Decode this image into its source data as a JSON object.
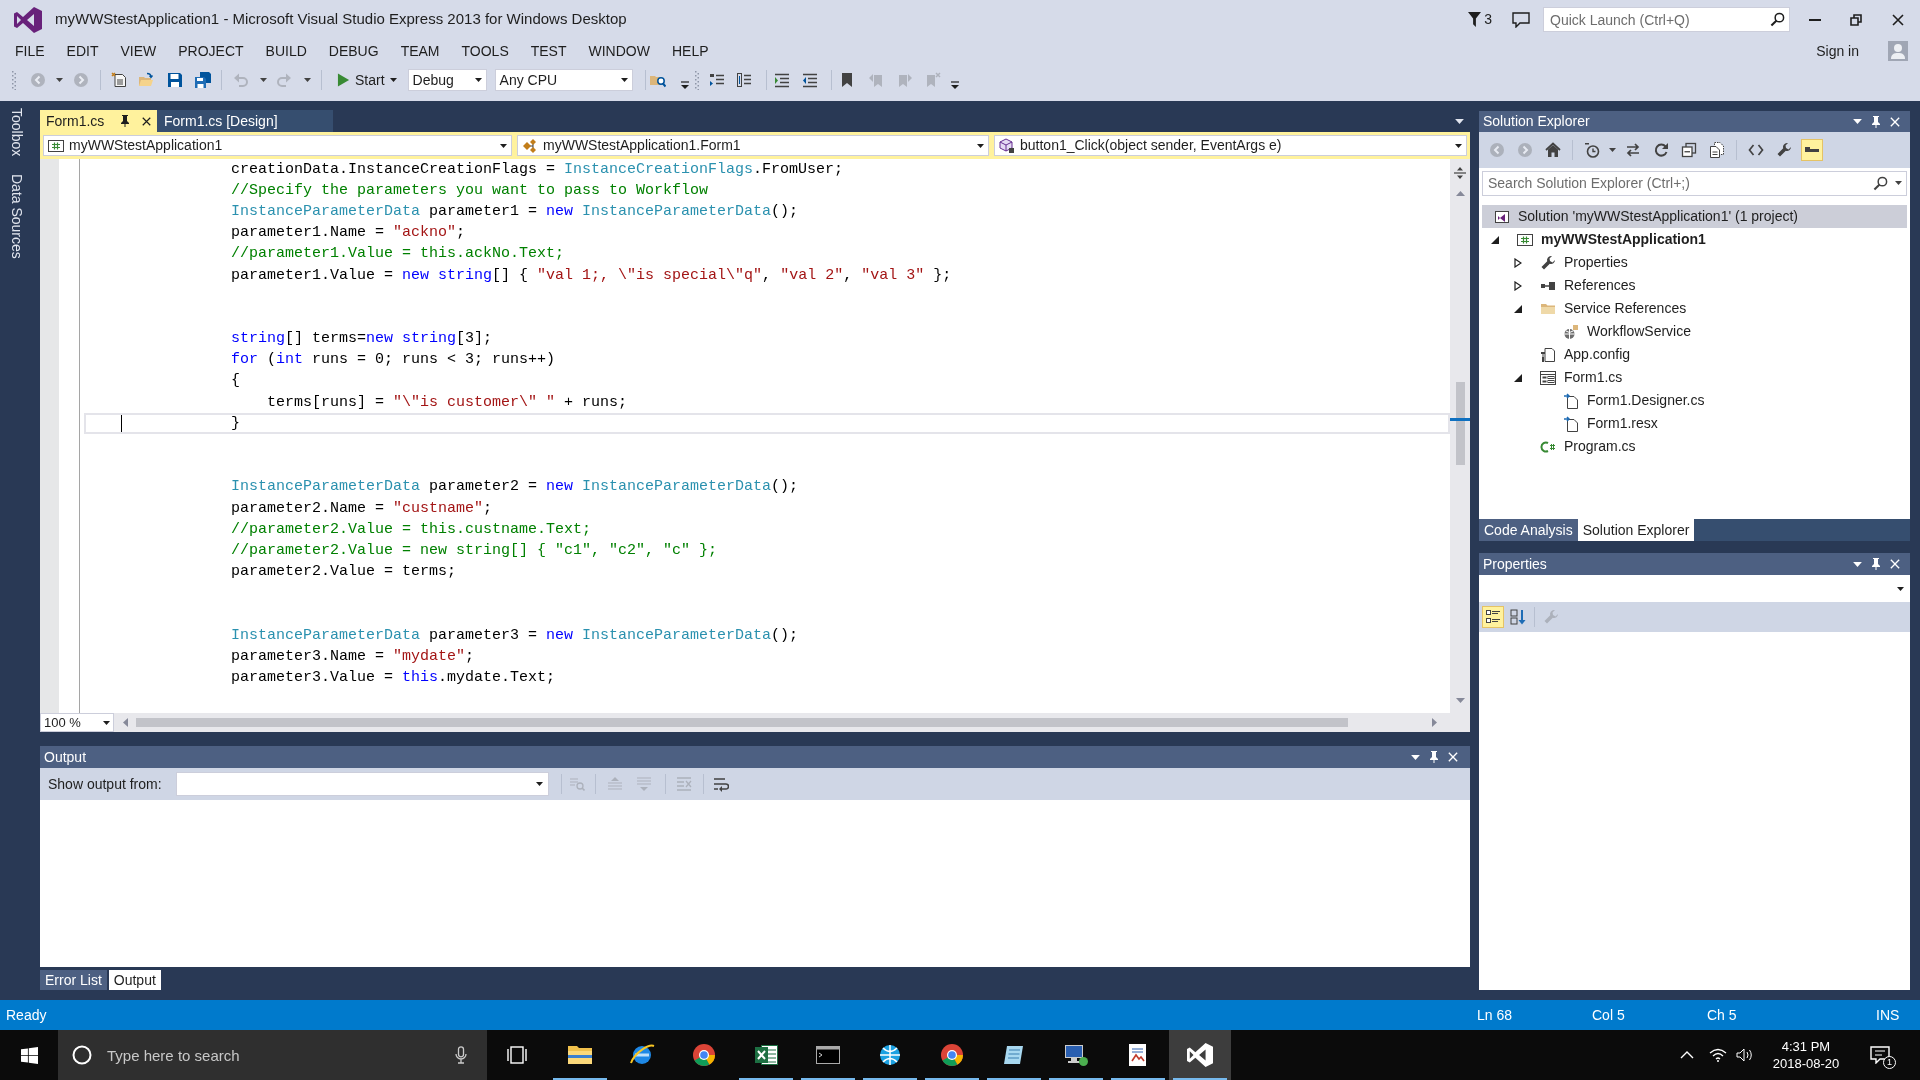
{
  "window": {
    "title": "myWWStestApplication1 - Microsoft Visual Studio Express 2013 for Windows Desktop",
    "notifications": "3",
    "quick_launch": {
      "placeholder": "Quick Launch (Ctrl+Q)"
    },
    "sign_in": "Sign in"
  },
  "menu": [
    "FILE",
    "EDIT",
    "VIEW",
    "PROJECT",
    "BUILD",
    "DEBUG",
    "TEAM",
    "TOOLS",
    "TEST",
    "WINDOW",
    "HELP"
  ],
  "toolbar": {
    "buttons_left": [
      {
        "disabled": true
      },
      {
        "disabled": true
      },
      {
        "disabled": false
      },
      {
        "disabled": false
      },
      {
        "disabled": false
      },
      {
        "disabled": false
      },
      {
        "disabled": true
      },
      {
        "disabled": true
      }
    ],
    "start": "Start",
    "configuration": "Debug",
    "platform": "Any CPU",
    "buttons_right": [
      {
        "disabled": false
      },
      {
        "disabled": false
      },
      {
        "disabled": false
      },
      {
        "disabled": false
      },
      {
        "disabled": false
      },
      {
        "disabled": false
      },
      {
        "disabled": true
      },
      {
        "disabled": true
      },
      {
        "disabled": true
      }
    ]
  },
  "side_tabs": [
    "Toolbox",
    "Data Sources"
  ],
  "editor": {
    "tabs": [
      {
        "label": "Form1.cs",
        "selected": true
      },
      {
        "label": "Form1.cs [Design]",
        "selected": false
      }
    ],
    "nav": [
      "myWWStestApplication1",
      "myWWStestApplication1.Form1",
      "button1_Click(object sender, EventArgs e)"
    ],
    "blocks": [
      {
        "lines": [
          {
            "current": false,
            "tokens": [
              {
                "kind": "plain",
                "text": "creationData.InstanceCreationFlags = "
              },
              {
                "kind": "type",
                "text": "InstanceCreationFlags"
              },
              {
                "kind": "plain",
                "text": ".FromUser;"
              }
            ]
          },
          {
            "current": false,
            "tokens": [
              {
                "kind": "comment",
                "text": "//Specify the parameters you want to pass to Workflow"
              }
            ]
          },
          {
            "current": false,
            "tokens": [
              {
                "kind": "type",
                "text": "InstanceParameterData"
              },
              {
                "kind": "plain",
                "text": " parameter1 = "
              },
              {
                "kind": "keyword",
                "text": "new "
              },
              {
                "kind": "type",
                "text": "InstanceParameterData"
              },
              {
                "kind": "plain",
                "text": "();"
              }
            ]
          },
          {
            "current": false,
            "tokens": [
              {
                "kind": "plain",
                "text": "parameter1.Name = "
              },
              {
                "kind": "string",
                "text": "\"ackno\""
              },
              {
                "kind": "plain",
                "text": ";"
              }
            ]
          },
          {
            "current": false,
            "tokens": [
              {
                "kind": "comment",
                "text": "//parameter1.Value = this.ackNo.Text;"
              }
            ]
          },
          {
            "current": false,
            "tokens": [
              {
                "kind": "plain",
                "text": "parameter1.Value = "
              },
              {
                "kind": "keyword",
                "text": "new string"
              },
              {
                "kind": "plain",
                "text": "[] { "
              },
              {
                "kind": "string",
                "text": "\"val 1;, \\\"is special\\\"q\""
              },
              {
                "kind": "plain",
                "text": ", "
              },
              {
                "kind": "string",
                "text": "\"val 2\""
              },
              {
                "kind": "plain",
                "text": ", "
              },
              {
                "kind": "string",
                "text": "\"val 3\""
              },
              {
                "kind": "plain",
                "text": " };"
              }
            ]
          }
        ]
      },
      {
        "lines": [
          {
            "current": false,
            "tokens": [
              {
                "kind": "keyword",
                "text": "string"
              },
              {
                "kind": "plain",
                "text": "[] terms="
              },
              {
                "kind": "keyword",
                "text": "new string"
              },
              {
                "kind": "plain",
                "text": "[3];"
              }
            ]
          },
          {
            "current": false,
            "tokens": [
              {
                "kind": "keyword",
                "text": "for"
              },
              {
                "kind": "plain",
                "text": " ("
              },
              {
                "kind": "keyword",
                "text": "int"
              },
              {
                "kind": "plain",
                "text": " runs = 0; runs < 3; runs++)"
              }
            ]
          },
          {
            "current": false,
            "tokens": [
              {
                "kind": "plain",
                "text": "{"
              }
            ],
            "children": [
              {
                "current": false,
                "tokens": [
                  {
                    "kind": "plain",
                    "text": "terms[runs] = "
                  },
                  {
                    "kind": "string",
                    "text": "\"\\\"is customer\\\" \""
                  },
                  {
                    "kind": "plain",
                    "text": " + runs;"
                  }
                ]
              }
            ]
          },
          {
            "current": true,
            "tokens": [
              {
                "kind": "plain",
                "text": "}"
              }
            ]
          }
        ]
      },
      {
        "lines": [
          {
            "current": false,
            "tokens": [
              {
                "kind": "type",
                "text": "InstanceParameterData"
              },
              {
                "kind": "plain",
                "text": " parameter2 = "
              },
              {
                "kind": "keyword",
                "text": "new "
              },
              {
                "kind": "type",
                "text": "InstanceParameterData"
              },
              {
                "kind": "plain",
                "text": "();"
              }
            ]
          },
          {
            "current": false,
            "tokens": [
              {
                "kind": "plain",
                "text": "parameter2.Name = "
              },
              {
                "kind": "string",
                "text": "\"custname\""
              },
              {
                "kind": "plain",
                "text": ";"
              }
            ]
          },
          {
            "current": false,
            "tokens": [
              {
                "kind": "comment",
                "text": "//parameter2.Value = this.custname.Text;"
              }
            ]
          },
          {
            "current": false,
            "tokens": [
              {
                "kind": "comment",
                "text": "//parameter2.Value = new string[] { \"c1\", \"c2\", \"c\" };"
              }
            ]
          },
          {
            "current": false,
            "tokens": [
              {
                "kind": "plain",
                "text": "parameter2.Value = terms;"
              }
            ]
          }
        ]
      },
      {
        "lines": [
          {
            "current": false,
            "tokens": [
              {
                "kind": "type",
                "text": "InstanceParameterData"
              },
              {
                "kind": "plain",
                "text": " parameter3 = "
              },
              {
                "kind": "keyword",
                "text": "new "
              },
              {
                "kind": "type",
                "text": "InstanceParameterData"
              },
              {
                "kind": "plain",
                "text": "();"
              }
            ]
          },
          {
            "current": false,
            "tokens": [
              {
                "kind": "plain",
                "text": "parameter3.Name = "
              },
              {
                "kind": "string",
                "text": "\"mydate\""
              },
              {
                "kind": "plain",
                "text": ";"
              }
            ]
          },
          {
            "current": false,
            "tokens": [
              {
                "kind": "plain",
                "text": "parameter3.Value = "
              },
              {
                "kind": "keyword",
                "text": "this"
              },
              {
                "kind": "plain",
                "text": ".mydate.Text;"
              }
            ]
          }
        ]
      }
    ],
    "zoom": "100 %"
  },
  "output": {
    "title": "Output",
    "show_output_from": "Show output from:",
    "buttons": [
      {
        "disabled": true
      },
      {
        "disabled": true
      },
      {
        "disabled": true
      },
      {
        "disabled": true
      },
      {
        "disabled": false
      }
    ]
  },
  "bottom_tabs": [
    {
      "label": "Error List",
      "selected": false
    },
    {
      "label": "Output",
      "selected": true
    }
  ],
  "solution_explorer": {
    "title": "Solution Explorer",
    "buttons": [
      {
        "disabled": true,
        "on": false
      },
      {
        "disabled": true,
        "on": false
      },
      {
        "disabled": false,
        "on": false
      },
      {
        "disabled": false,
        "on": false
      },
      {
        "disabled": false,
        "on": false
      },
      {
        "disabled": false,
        "on": false
      },
      {
        "disabled": false,
        "on": false
      },
      {
        "disabled": false,
        "on": false
      },
      {
        "disabled": false,
        "on": false
      },
      {
        "disabled": false,
        "on": false
      },
      {
        "disabled": false,
        "on": true
      }
    ],
    "search": {
      "placeholder": "Search Solution Explorer (Ctrl+;)"
    },
    "tree": [
      {
        "label": "Solution 'myWWStestApplication1' (1 project)",
        "kind": "solution",
        "selected": true,
        "children": [
          {
            "label": "myWWStestApplication1",
            "kind": "project",
            "selected": false,
            "expanded": true,
            "children": [
              {
                "label": "Properties",
                "kind": "properties",
                "selected": false,
                "expanded": false
              },
              {
                "label": "References",
                "kind": "references",
                "selected": false,
                "expanded": false
              },
              {
                "label": "Service References",
                "kind": "folder",
                "selected": false,
                "expanded": true,
                "children": [
                  {
                    "label": "WorkflowService",
                    "kind": "service",
                    "selected": false
                  }
                ]
              },
              {
                "label": "App.config",
                "kind": "config",
                "selected": false
              },
              {
                "label": "Form1.cs",
                "kind": "form",
                "selected": false,
                "expanded": true,
                "children": [
                  {
                    "label": "Form1.Designer.cs",
                    "kind": "linked-file",
                    "selected": false
                  },
                  {
                    "label": "Form1.resx",
                    "kind": "linked-file",
                    "selected": false
                  }
                ]
              },
              {
                "label": "Program.cs",
                "kind": "code-file",
                "selected": false
              }
            ]
          }
        ]
      }
    ]
  },
  "right_tabs": [
    {
      "label": "Code Analysis",
      "selected": false
    },
    {
      "label": "Solution Explorer",
      "selected": true
    }
  ],
  "properties": {
    "title": "Properties",
    "buttons": [
      {
        "disabled": false,
        "on": true
      },
      {
        "disabled": false,
        "on": false
      },
      {
        "disabled": true,
        "on": false
      }
    ]
  },
  "status_bar": {
    "message": "Ready",
    "line": "Ln 68",
    "column": "Col 5",
    "char": "Ch 5",
    "mode": "INS"
  },
  "taskbar": {
    "search": {
      "placeholder": "Type here to search"
    },
    "apps": [
      {
        "running": true,
        "selected": false
      },
      {
        "running": false,
        "selected": false
      },
      {
        "running": false,
        "selected": false
      },
      {
        "running": true,
        "selected": false
      },
      {
        "running": true,
        "selected": false
      },
      {
        "running": true,
        "selected": false
      },
      {
        "running": true,
        "selected": false
      },
      {
        "running": true,
        "selected": false
      },
      {
        "running": true,
        "selected": false
      },
      {
        "running": true,
        "selected": false
      },
      {
        "running": true,
        "selected": true
      }
    ],
    "time": "4:31 PM",
    "date": "2018-08-20",
    "notification_count": "1"
  }
}
